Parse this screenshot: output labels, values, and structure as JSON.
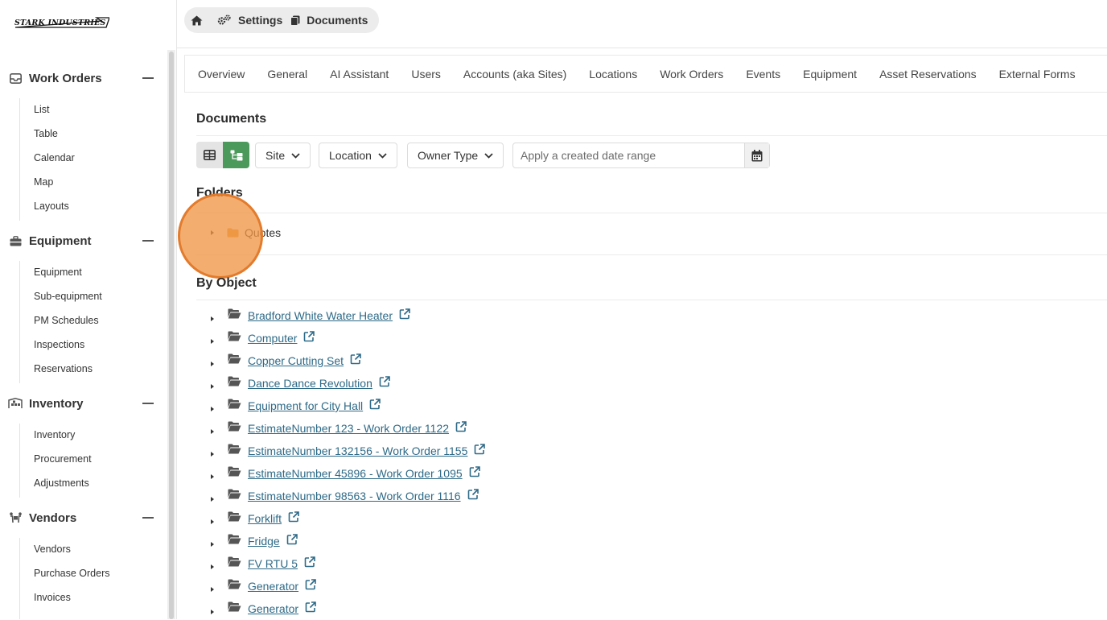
{
  "app": {
    "logo_text": "STARK INDUSTRIES"
  },
  "breadcrumb": {
    "items": [
      {
        "label": "",
        "icon": "home-icon"
      },
      {
        "label": "Settings",
        "icon": "gears-icon"
      },
      {
        "label": "Documents",
        "icon": "documents-icon"
      }
    ]
  },
  "sidebar": {
    "sections": [
      {
        "title": "Work Orders",
        "icon": "tray-icon",
        "items": [
          "List",
          "Table",
          "Calendar",
          "Map",
          "Layouts"
        ]
      },
      {
        "title": "Equipment",
        "icon": "toolbox-icon",
        "items": [
          "Equipment",
          "Sub-equipment",
          "PM Schedules",
          "Inspections",
          "Reservations"
        ]
      },
      {
        "title": "Inventory",
        "icon": "warehouse-icon",
        "items": [
          "Inventory",
          "Procurement",
          "Adjustments"
        ]
      },
      {
        "title": "Vendors",
        "icon": "people-carry-icon",
        "items": [
          "Vendors",
          "Purchase Orders",
          "Invoices"
        ]
      }
    ]
  },
  "tabs": [
    "Overview",
    "General",
    "AI Assistant",
    "Users",
    "Accounts (aka Sites)",
    "Locations",
    "Work Orders",
    "Events",
    "Equipment",
    "Asset Reservations",
    "External Forms"
  ],
  "documents": {
    "title": "Documents",
    "filters": {
      "site": "Site",
      "location": "Location",
      "owner_type": "Owner Type",
      "date_placeholder": "Apply a created date range"
    },
    "folders_title": "Folders",
    "folders": [
      "Quotes"
    ],
    "by_object_title": "By Object",
    "objects": [
      "Bradford White Water Heater",
      "Computer",
      "Copper Cutting Set",
      "Dance Dance Revolution",
      "Equipment for City Hall",
      "EstimateNumber 123 - Work Order 1122",
      "EstimateNumber 132156 - Work Order 1155",
      "EstimateNumber 45896 - Work Order 1095",
      "EstimateNumber 98563 - Work Order 1116",
      "Forklift",
      "Fridge",
      "FV RTU 5",
      "Generator",
      "Generator"
    ]
  },
  "colors": {
    "accent_green": "#4b9a5c",
    "link": "#2e6a87",
    "folder_orange": "#e8a13a",
    "click_indicator": "#f0964a"
  }
}
